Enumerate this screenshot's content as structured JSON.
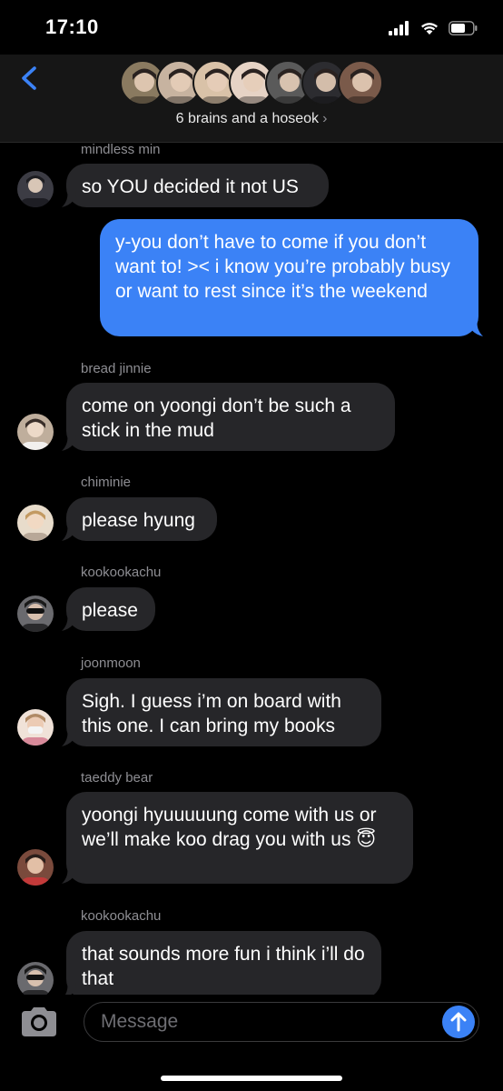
{
  "status": {
    "time": "17:10"
  },
  "header": {
    "group_name": "6 brains and a hoseok",
    "chevron": "›",
    "avatars": [
      "#8a7a60",
      "#c7b3a0",
      "#d9c2a8",
      "#e6d3c5",
      "#5a5a5a",
      "#2c2c30",
      "#7a5a4a"
    ]
  },
  "messages": [
    {
      "sender": "mindless min",
      "text": "so YOU decided it not US",
      "direction": "incoming",
      "avatar_color": "#3c3c44"
    },
    {
      "text": "y-you don’t have to come if you don’t want to! >< i know you’re probably busy or want to rest since it’s the weekend",
      "direction": "outgoing"
    },
    {
      "sender": "bread jinnie",
      "text": "come on yoongi don’t be such a stick in the mud",
      "direction": "incoming",
      "avatar_color": "#c8b6a4"
    },
    {
      "sender": "chiminie",
      "text": "please hyung",
      "direction": "incoming",
      "avatar_color": "#d8c4a8"
    },
    {
      "sender": "kookookachu",
      "text": "please",
      "direction": "incoming",
      "avatar_color": "#4a4a4c"
    },
    {
      "sender": "joonmoon",
      "text": "Sigh. I guess i’m on board with this one. I can bring my books",
      "direction": "incoming",
      "avatar_color": "#e2cfc2"
    },
    {
      "sender": "taeddy bear",
      "text": "yoongi hyuuuuung come with us or we’ll make koo drag you with us 😇",
      "direction": "incoming",
      "avatar_color": "#8a5a4a"
    },
    {
      "sender": "kookookachu",
      "text": "that sounds more fun i think i’ll do that",
      "direction": "incoming",
      "avatar_color": "#4a4a4c"
    }
  ],
  "input": {
    "placeholder": "Message"
  },
  "colors": {
    "outgoing_bubble": "#3b82f6",
    "incoming_bubble": "#262629",
    "accent": "#3b82f6"
  }
}
